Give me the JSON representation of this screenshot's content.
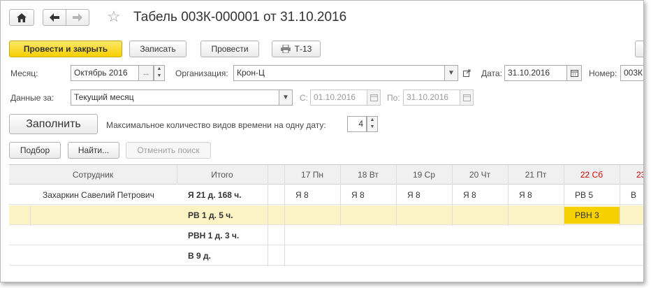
{
  "header": {
    "title": "Табель 003К-000001 от 31.10.2016"
  },
  "toolbar": {
    "post_close": "Провести и закрыть",
    "save": "Записать",
    "post": "Провести",
    "print": "Т-13"
  },
  "form": {
    "month_label": "Месяц:",
    "month_value": "Октябрь 2016",
    "month_dots": "...",
    "org_label": "Организация:",
    "org_value": "Крон-Ц",
    "date_label": "Дата:",
    "date_value": "31.10.2016",
    "number_label": "Номер:",
    "number_value": "003К",
    "data_for_label": "Данные за:",
    "data_for_value": "Текущий месяц",
    "from_label": "С:",
    "from_value": "01.10.2016",
    "to_label": "По:",
    "to_value": "31.10.2016",
    "fill_button": "Заполнить",
    "max_label": "Максимальное количество видов времени на одну дату:",
    "max_value": "4"
  },
  "table_toolbar": {
    "select": "Подбор",
    "find": "Найти...",
    "cancel_search": "Отменить поиск"
  },
  "table": {
    "col_employee": "Сотрудник",
    "col_total": "Итого",
    "days": [
      {
        "label": "17 Пн",
        "weekend": false
      },
      {
        "label": "18 Вт",
        "weekend": false
      },
      {
        "label": "19 Ср",
        "weekend": false
      },
      {
        "label": "20 Чт",
        "weekend": false
      },
      {
        "label": "21 Пт",
        "weekend": false
      },
      {
        "label": "22 Сб",
        "weekend": true
      },
      {
        "label": "23",
        "weekend": true
      }
    ],
    "rows": [
      {
        "employee": "Захаркин Савелий Петрович",
        "total": "Я 21 д. 168 ч.",
        "cells": [
          "Я 8",
          "Я 8",
          "Я 8",
          "Я 8",
          "Я 8",
          "РВ 5",
          "В"
        ]
      },
      {
        "employee": "",
        "total": "РВ 1 д. 5 ч.",
        "cells": [
          "",
          "",
          "",
          "",
          "",
          "РВН 3",
          ""
        ]
      },
      {
        "employee": "",
        "total": "РВН 1 д. 3 ч.",
        "cells": [
          "",
          "",
          "",
          "",
          "",
          "",
          ""
        ]
      },
      {
        "employee": "",
        "total": "В 9 д.",
        "cells": [
          "",
          "",
          "",
          "",
          "",
          "",
          ""
        ]
      }
    ]
  },
  "colors": {
    "primary": "#f5cf00",
    "selected_row": "#fbf3c4",
    "active_cell": "#f5d100",
    "weekend": "#d40000"
  }
}
